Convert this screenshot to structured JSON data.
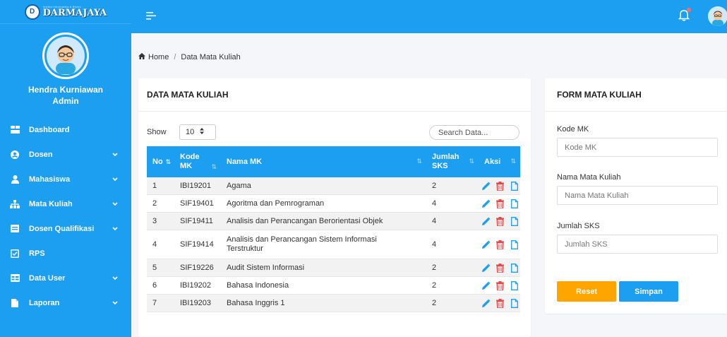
{
  "brand": {
    "small_text": "Institut Informatika & Bisnis",
    "name": "DARMAJAYA"
  },
  "profile": {
    "name": "Hendra Kurniawan",
    "role": "Admin"
  },
  "sidebar": {
    "items": [
      {
        "label": "Dashboard",
        "icon": "dashboard-icon",
        "has_submenu": false
      },
      {
        "label": "Dosen",
        "icon": "user-circle-icon",
        "has_submenu": true
      },
      {
        "label": "Mahasiswa",
        "icon": "user-icon",
        "has_submenu": true
      },
      {
        "label": "Mata Kuliah",
        "icon": "sitemap-icon",
        "has_submenu": true
      },
      {
        "label": "Dosen Qualifikasi",
        "icon": "card-icon",
        "has_submenu": true
      },
      {
        "label": "RPS",
        "icon": "checkbox-icon",
        "has_submenu": false
      },
      {
        "label": "Data User",
        "icon": "table-icon",
        "has_submenu": true
      },
      {
        "label": "Laporan",
        "icon": "file-icon",
        "has_submenu": true
      }
    ]
  },
  "breadcrumb": {
    "home": "Home",
    "separator": "/",
    "current": "Data Mata Kuliah"
  },
  "data_card": {
    "title": "DATA MATA KULIAH",
    "show_label": "Show",
    "page_size": "10",
    "search_placeholder": "Search Data...",
    "columns": [
      "No",
      "Kode MK",
      "Nama MK",
      "Jumlah SKS",
      "Aksi"
    ],
    "rows": [
      {
        "no": "1",
        "kode": "IBI19201",
        "nama": "Agama",
        "sks": "2"
      },
      {
        "no": "2",
        "kode": "SIF19401",
        "nama": "Agoritma dan Pemrograman",
        "sks": "4"
      },
      {
        "no": "3",
        "kode": "SIF19411",
        "nama": "Analisis dan Perancangan Berorientasi Objek",
        "sks": "4"
      },
      {
        "no": "4",
        "kode": "SIF19414",
        "nama": "Analisis dan Perancangan Sistem Informasi Terstruktur",
        "sks": "4"
      },
      {
        "no": "5",
        "kode": "SIF19226",
        "nama": "Audit Sistem Informasi",
        "sks": "2"
      },
      {
        "no": "6",
        "kode": "IBI19202",
        "nama": "Bahasa Indonesia",
        "sks": "2"
      },
      {
        "no": "7",
        "kode": "IBI19203",
        "nama": "Bahasa Inggris 1",
        "sks": "2"
      }
    ]
  },
  "form_card": {
    "title": "FORM MATA KULIAH",
    "kode_label": "Kode MK",
    "kode_placeholder": "Kode MK",
    "nama_label": "Nama Mata Kuliah",
    "nama_placeholder": "Nama Mata Kuliah",
    "sks_label": "Jumlah SKS",
    "sks_placeholder": "Jumlah SKS",
    "reset_label": "Reset",
    "simpan_label": "Simpan"
  },
  "colors": {
    "primary": "#1c9ff0",
    "warning": "#ffa500",
    "edit": "#1c9ff0",
    "delete": "#e04b4b",
    "background": "#f4f6f9"
  }
}
